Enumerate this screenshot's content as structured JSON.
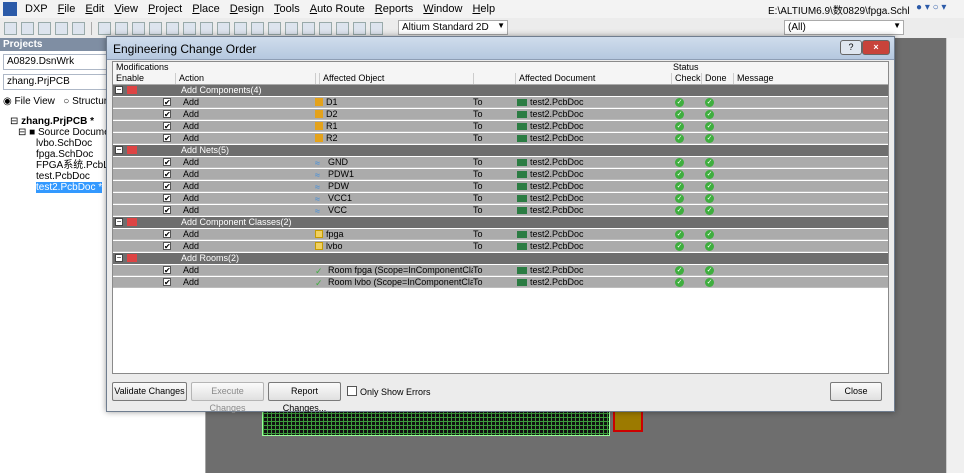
{
  "menubar": {
    "items": [
      "DXP",
      "File",
      "Edit",
      "View",
      "Project",
      "Place",
      "Design",
      "Tools",
      "Auto Route",
      "Reports",
      "Window",
      "Help"
    ],
    "path": "E:\\ALTIUM6.9\\数0829\\fpga.Schl"
  },
  "toolbar": {
    "view_combo": "Altium Standard 2D",
    "filter_combo": "(All)"
  },
  "projects_panel": {
    "title": "Projects",
    "workspace_value": "A0829.DsnWrk",
    "project_value": "zhang.PrjPCB",
    "radio_file_view": "File View",
    "radio_structure": "Structure E",
    "tree": {
      "project": "zhang.PrjPCB *",
      "folder": "Source Documents",
      "docs": [
        "lvbo.SchDoc",
        "fpga.SchDoc",
        "FPGA系统.PcbL",
        "test.PcbDoc",
        "test2.PcbDoc *"
      ]
    }
  },
  "dialog": {
    "title": "Engineering Change Order",
    "header": {
      "modifications": "Modifications",
      "status": "Status",
      "enable": "Enable",
      "action": "Action",
      "affected_object": "Affected Object",
      "affected_document": "Affected Document",
      "check": "Check",
      "done": "Done",
      "message": "Message"
    },
    "groups": [
      {
        "label": "Add Components(4)",
        "icon": "component-icon",
        "rows": [
          {
            "action": "Add",
            "object": "D1",
            "to": "To",
            "document": "test2.PcbDoc"
          },
          {
            "action": "Add",
            "object": "D2",
            "to": "To",
            "document": "test2.PcbDoc"
          },
          {
            "action": "Add",
            "object": "R1",
            "to": "To",
            "document": "test2.PcbDoc"
          },
          {
            "action": "Add",
            "object": "R2",
            "to": "To",
            "document": "test2.PcbDoc"
          }
        ]
      },
      {
        "label": "Add Nets(5)",
        "icon": "net-icon",
        "rows": [
          {
            "action": "Add",
            "object": "GND",
            "to": "To",
            "document": "test2.PcbDoc"
          },
          {
            "action": "Add",
            "object": "PDW1",
            "to": "To",
            "document": "test2.PcbDoc"
          },
          {
            "action": "Add",
            "object": "PDW",
            "to": "To",
            "document": "test2.PcbDoc"
          },
          {
            "action": "Add",
            "object": "VCC1",
            "to": "To",
            "document": "test2.PcbDoc"
          },
          {
            "action": "Add",
            "object": "VCC",
            "to": "To",
            "document": "test2.PcbDoc"
          }
        ]
      },
      {
        "label": "Add Component Classes(2)",
        "icon": "class-icon",
        "rows": [
          {
            "action": "Add",
            "object": "fpga",
            "to": "To",
            "document": "test2.PcbDoc"
          },
          {
            "action": "Add",
            "object": "lvbo",
            "to": "To",
            "document": "test2.PcbDoc"
          }
        ]
      },
      {
        "label": "Add Rooms(2)",
        "icon": "room-icon",
        "rows": [
          {
            "action": "Add",
            "object": "Room fpga (Scope=InComponentClass('fp",
            "to": "To",
            "document": "test2.PcbDoc"
          },
          {
            "action": "Add",
            "object": "Room lvbo (Scope=InComponentClass('lv",
            "to": "To",
            "document": "test2.PcbDoc"
          }
        ]
      }
    ],
    "buttons": {
      "validate": "Validate Changes",
      "execute": "Execute Changes",
      "report": "Report Changes...",
      "only_errors": "Only Show Errors",
      "close": "Close"
    }
  }
}
